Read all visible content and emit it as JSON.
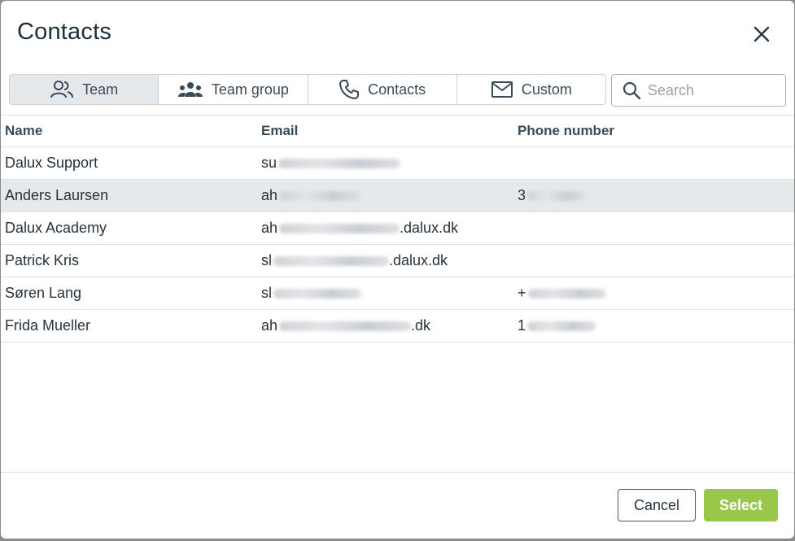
{
  "dialog": {
    "title": "Contacts"
  },
  "tabs": [
    {
      "label": "Team",
      "icon": "team-icon",
      "active": true
    },
    {
      "label": "Team group",
      "icon": "team-group-icon",
      "active": false
    },
    {
      "label": "Contacts",
      "icon": "phone-icon",
      "active": false
    },
    {
      "label": "Custom",
      "icon": "mail-icon",
      "active": false
    }
  ],
  "search": {
    "placeholder": "Search",
    "value": ""
  },
  "table": {
    "columns": [
      "Name",
      "Email",
      "Phone number"
    ],
    "rows": [
      {
        "name": "Dalux Support",
        "email_prefix": "su",
        "email_suffix": "",
        "phone_prefix": "",
        "selected": false
      },
      {
        "name": "Anders Laursen",
        "email_prefix": "ah",
        "email_suffix": "",
        "phone_prefix": "3",
        "selected": true
      },
      {
        "name": "Dalux Academy",
        "email_prefix": "ah",
        "email_suffix": ".dalux.dk",
        "phone_prefix": "",
        "selected": false
      },
      {
        "name": "Patrick Kris",
        "email_prefix": "sl",
        "email_suffix": ".dalux.dk",
        "phone_prefix": "",
        "selected": false
      },
      {
        "name": "Søren Lang",
        "email_prefix": "sl",
        "email_suffix": "",
        "phone_prefix": "+",
        "selected": false
      },
      {
        "name": "Frida Mueller",
        "email_prefix": "ah",
        "email_suffix": ".dk",
        "phone_prefix": "1",
        "selected": false
      }
    ]
  },
  "footer": {
    "cancel_label": "Cancel",
    "select_label": "Select"
  },
  "colors": {
    "accent": "#98c84a",
    "active_tab": "#e6e9ec",
    "text": "#26323d"
  }
}
